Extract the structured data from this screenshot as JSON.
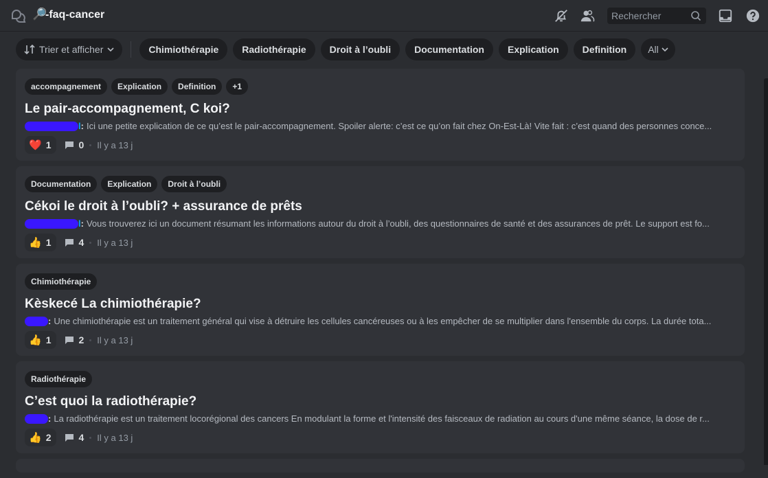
{
  "topbar": {
    "channel_emoji": "🔎",
    "channel_name": "-faq-cancer",
    "search_placeholder": "Rechercher",
    "icons": [
      "threads-icon",
      "bell-muted-icon",
      "members-icon",
      "search-icon",
      "inbox-icon",
      "help-icon"
    ]
  },
  "filters": {
    "sort_label": "Trier et afficher",
    "tags": [
      "Chimiothérapie",
      "Radiothérapie",
      "Droit à l’oubli",
      "Documentation",
      "Explication",
      "Definition"
    ],
    "all_label": "All"
  },
  "posts": [
    {
      "tags": [
        "accompagnement",
        "Explication",
        "Definition",
        "+1"
      ],
      "title": "Le pair-accompagnement, C koi?",
      "author_tail": "l",
      "snippet": "Ici une petite explication de ce qu’est le pair-accompagnement. Spoiler alerte: c’est ce qu’on fait chez On-Est-Là! Vite fait : c’est quand des personnes conce...",
      "reaction_emoji": "❤️",
      "reaction_count": "1",
      "comment_count": "0",
      "time": "Il y a 13 j"
    },
    {
      "tags": [
        "Documentation",
        "Explication",
        "Droit à l’oubli"
      ],
      "title": "Cékoi le droit à l’oubli? + assurance de prêts",
      "author_tail": "l",
      "snippet": "Vous trouverez ici un document résumant les informations autour du droit à l’oubli, des questionnaires de santé et des assurances de prêt. Le support est fo...",
      "reaction_emoji": "👍",
      "reaction_count": "1",
      "comment_count": "4",
      "time": "Il y a 13 j"
    },
    {
      "tags": [
        "Chimiothérapie"
      ],
      "title": "Kèskecé La chimiothérapie?",
      "author_tail": "",
      "snippet": "Une chimiothérapie est un traitement général qui vise à détruire les cellules cancéreuses ou à les empêcher de se multiplier dans l'ensemble du corps. La durée tota...",
      "reaction_emoji": "👍",
      "reaction_count": "1",
      "comment_count": "2",
      "time": "Il y a 13 j"
    },
    {
      "tags": [
        "Radiothérapie"
      ],
      "title": "C’est quoi la radiothérapie?",
      "author_tail": "",
      "snippet": "La radiothérapie est un traitement locorégional des cancers En modulant la forme et l'intensité des faisceaux de radiation au cours d'une même séance, la dose de r...",
      "reaction_emoji": "👍",
      "reaction_count": "2",
      "comment_count": "4",
      "time": "Il y a 13 j"
    }
  ],
  "colon": ":"
}
